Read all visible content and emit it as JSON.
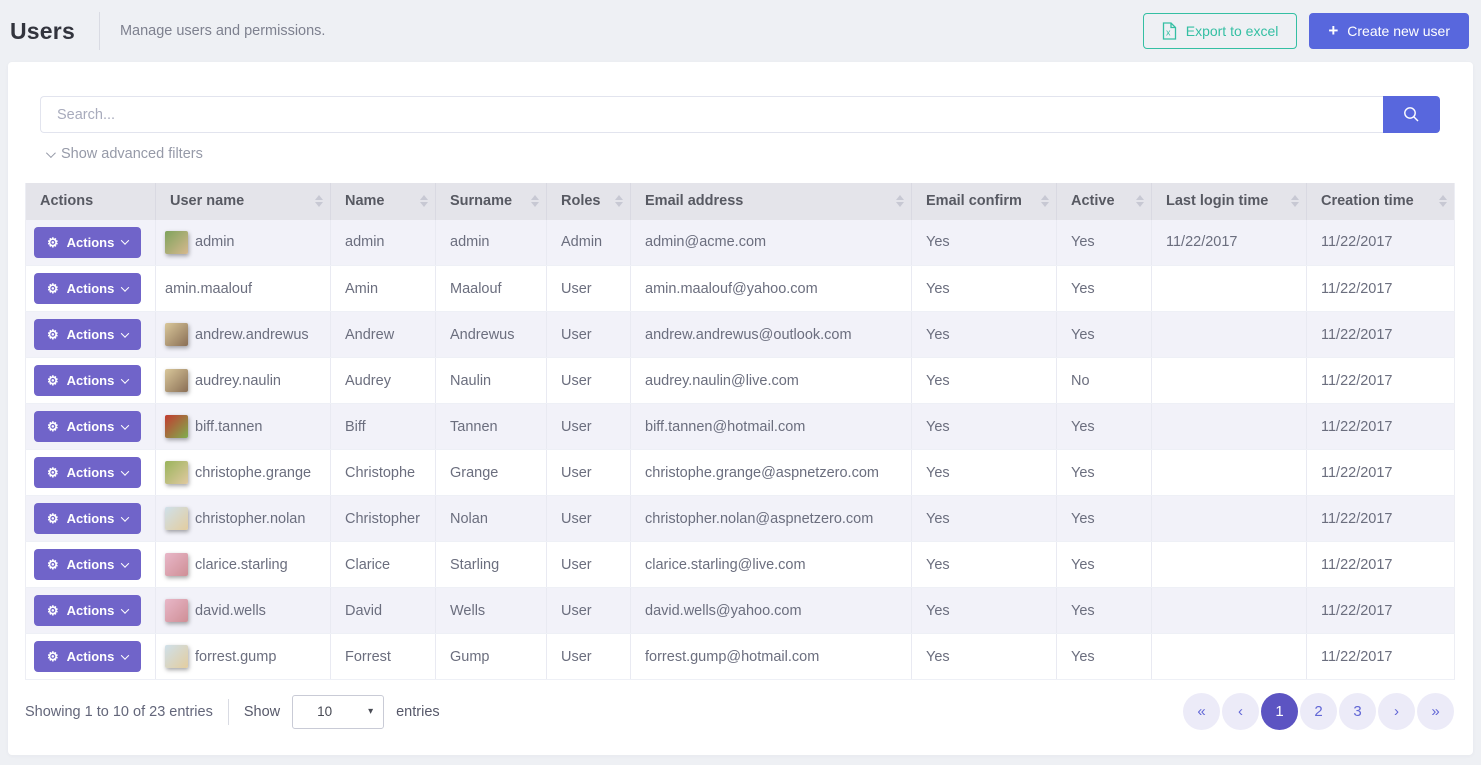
{
  "page": {
    "title": "Users",
    "subtitle": "Manage users and permissions."
  },
  "header_buttons": {
    "export": "Export to excel",
    "create": "Create new user"
  },
  "icons": {
    "gear": "⚙",
    "plus": "+",
    "select_caret": "▾"
  },
  "colors": {
    "accent_blue": "#5867dd",
    "accent_purple": "#7064c9",
    "success_green": "#34bfa3",
    "active_page": "#5c54c2",
    "header_bg": "#e4e4ea",
    "stripe_bg": "#f2f2f9"
  },
  "search": {
    "placeholder": "Search...",
    "advanced_filters": "Show advanced filters"
  },
  "table": {
    "actions_label": "Actions",
    "columns": [
      {
        "label": "Actions",
        "sortable": false
      },
      {
        "label": "User name",
        "sortable": true
      },
      {
        "label": "Name",
        "sortable": true
      },
      {
        "label": "Surname",
        "sortable": true
      },
      {
        "label": "Roles",
        "sortable": true
      },
      {
        "label": "Email address",
        "sortable": true
      },
      {
        "label": "Email confirm",
        "sortable": true
      },
      {
        "label": "Active",
        "sortable": true
      },
      {
        "label": "Last login time",
        "sortable": true
      },
      {
        "label": "Creation time",
        "sortable": true
      }
    ],
    "rows": [
      {
        "user_name": "admin",
        "name": "admin",
        "surname": "admin",
        "roles": "Admin",
        "email": "admin@acme.com",
        "email_confirm": "Yes",
        "active": "Yes",
        "last_login": "11/22/2017",
        "creation": "11/22/2017",
        "avatar": {
          "c1": "#7fa35c",
          "c2": "#d6b88e"
        }
      },
      {
        "user_name": "amin.maalouf",
        "name": "Amin",
        "surname": "Maalouf",
        "roles": "User",
        "email": "amin.maalouf@yahoo.com",
        "email_confirm": "Yes",
        "active": "Yes",
        "last_login": "",
        "creation": "11/22/2017",
        "avatar": null
      },
      {
        "user_name": "andrew.andrewus",
        "name": "Andrew",
        "surname": "Andrewus",
        "roles": "User",
        "email": "andrew.andrewus@outlook.com",
        "email_confirm": "Yes",
        "active": "Yes",
        "last_login": "",
        "creation": "11/22/2017",
        "avatar": {
          "c1": "#d9c79a",
          "c2": "#8a6f55"
        }
      },
      {
        "user_name": "audrey.naulin",
        "name": "Audrey",
        "surname": "Naulin",
        "roles": "User",
        "email": "audrey.naulin@live.com",
        "email_confirm": "Yes",
        "active": "No",
        "last_login": "",
        "creation": "11/22/2017",
        "avatar": {
          "c1": "#d9c79a",
          "c2": "#8a6f55"
        }
      },
      {
        "user_name": "biff.tannen",
        "name": "Biff",
        "surname": "Tannen",
        "roles": "User",
        "email": "biff.tannen@hotmail.com",
        "email_confirm": "Yes",
        "active": "Yes",
        "last_login": "",
        "creation": "11/22/2017",
        "avatar": {
          "c1": "#c23b30",
          "c2": "#7fae4e"
        }
      },
      {
        "user_name": "christophe.grange",
        "name": "Christophe",
        "surname": "Grange",
        "roles": "User",
        "email": "christophe.grange@aspnetzero.com",
        "email_confirm": "Yes",
        "active": "Yes",
        "last_login": "",
        "creation": "11/22/2017",
        "avatar": {
          "c1": "#9ab45c",
          "c2": "#e0c9a0"
        }
      },
      {
        "user_name": "christopher.nolan",
        "name": "Christopher",
        "surname": "Nolan",
        "roles": "User",
        "email": "christopher.nolan@aspnetzero.com",
        "email_confirm": "Yes",
        "active": "Yes",
        "last_login": "",
        "creation": "11/22/2017",
        "avatar": {
          "c1": "#cfe0ea",
          "c2": "#e3cd9f"
        }
      },
      {
        "user_name": "clarice.starling",
        "name": "Clarice",
        "surname": "Starling",
        "roles": "User",
        "email": "clarice.starling@live.com",
        "email_confirm": "Yes",
        "active": "Yes",
        "last_login": "",
        "creation": "11/22/2017",
        "avatar": {
          "c1": "#e8b7c8",
          "c2": "#cf8f96"
        }
      },
      {
        "user_name": "david.wells",
        "name": "David",
        "surname": "Wells",
        "roles": "User",
        "email": "david.wells@yahoo.com",
        "email_confirm": "Yes",
        "active": "Yes",
        "last_login": "",
        "creation": "11/22/2017",
        "avatar": {
          "c1": "#e8b7c8",
          "c2": "#cf8f96"
        }
      },
      {
        "user_name": "forrest.gump",
        "name": "Forrest",
        "surname": "Gump",
        "roles": "User",
        "email": "forrest.gump@hotmail.com",
        "email_confirm": "Yes",
        "active": "Yes",
        "last_login": "",
        "creation": "11/22/2017",
        "avatar": {
          "c1": "#cfe0ea",
          "c2": "#e3cd9f"
        }
      }
    ]
  },
  "footer": {
    "showing_text": "Showing 1 to 10 of 23 entries",
    "show_label": "Show",
    "page_size": "10",
    "entries_label": "entries",
    "pagination": [
      {
        "label": "«",
        "name": "first-page",
        "active": false
      },
      {
        "label": "‹",
        "name": "prev-page",
        "active": false
      },
      {
        "label": "1",
        "name": "page-1",
        "active": true
      },
      {
        "label": "2",
        "name": "page-2",
        "active": false
      },
      {
        "label": "3",
        "name": "page-3",
        "active": false
      },
      {
        "label": "›",
        "name": "next-page",
        "active": false
      },
      {
        "label": "»",
        "name": "last-page",
        "active": false
      }
    ]
  }
}
